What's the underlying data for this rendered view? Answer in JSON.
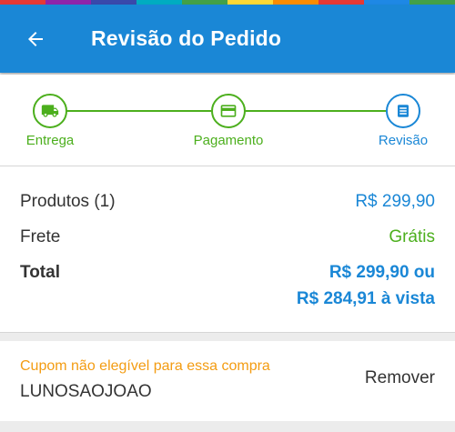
{
  "header": {
    "title": "Revisão do Pedido",
    "back_icon": "arrow-left-icon"
  },
  "colors": {
    "primary": "#1a87d6",
    "success": "#4caf1d",
    "warning": "#f39c12"
  },
  "steps": [
    {
      "label": "Entrega",
      "icon": "truck-icon",
      "status": "done"
    },
    {
      "label": "Pagamento",
      "icon": "credit-card-icon",
      "status": "done"
    },
    {
      "label": "Revisão",
      "icon": "list-icon",
      "status": "active"
    }
  ],
  "summary": {
    "products_label": "Produtos (1)",
    "products_value": "R$ 299,90",
    "shipping_label": "Frete",
    "shipping_value": "Grátis",
    "total_label": "Total",
    "total_value": "R$ 299,90 ou",
    "total_cash": "R$ 284,91 à vista"
  },
  "coupon": {
    "message": "Cupom não elegível para essa compra",
    "code": "LUNOSAOJOAO",
    "remove_label": "Remover"
  }
}
